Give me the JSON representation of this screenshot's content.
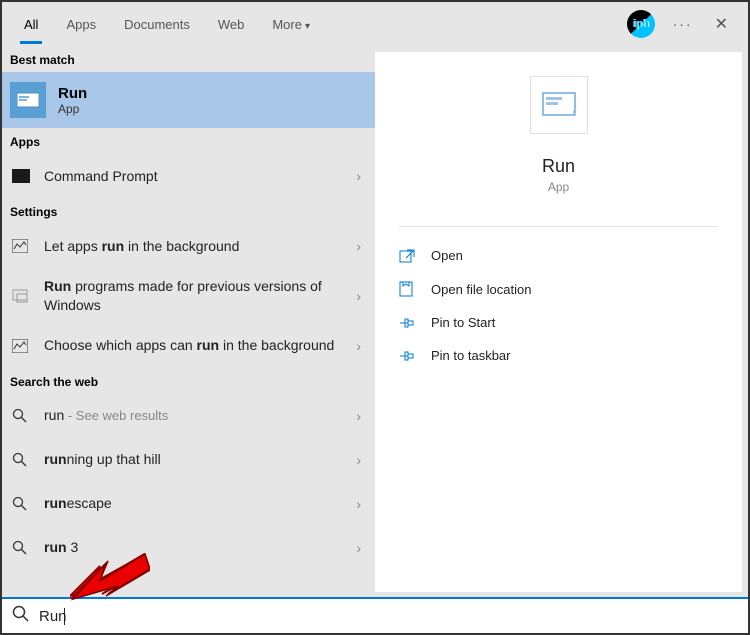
{
  "tabs": {
    "items": [
      "All",
      "Apps",
      "Documents",
      "Web",
      "More"
    ],
    "active_index": 0
  },
  "sections": {
    "best_match": {
      "header": "Best match",
      "title": "Run",
      "subtitle": "App"
    },
    "apps": {
      "header": "Apps",
      "items": [
        {
          "label_html": "Command Prompt"
        }
      ]
    },
    "settings": {
      "header": "Settings",
      "items": [
        {
          "parts": [
            "Let apps ",
            "run",
            " in the background"
          ],
          "bold_idx": 1
        },
        {
          "parts": [
            "Run",
            " programs made for previous versions of Windows"
          ],
          "bold_idx": 0
        },
        {
          "parts": [
            "Choose which apps can ",
            "run",
            " in the background"
          ],
          "bold_idx": 1
        }
      ]
    },
    "web": {
      "header": "Search the web",
      "items": [
        {
          "parts": [
            "run"
          ],
          "hint": " - See web results"
        },
        {
          "parts": [
            "run",
            "ning up that hill"
          ],
          "bold_idx": 0
        },
        {
          "parts": [
            "run",
            "escape"
          ],
          "bold_idx": 0
        },
        {
          "parts": [
            "run",
            " 3"
          ],
          "bold_idx": 0
        }
      ]
    }
  },
  "preview": {
    "title": "Run",
    "subtitle": "App",
    "actions": [
      "Open",
      "Open file location",
      "Pin to Start",
      "Pin to taskbar"
    ]
  },
  "search": {
    "value": "Run"
  }
}
